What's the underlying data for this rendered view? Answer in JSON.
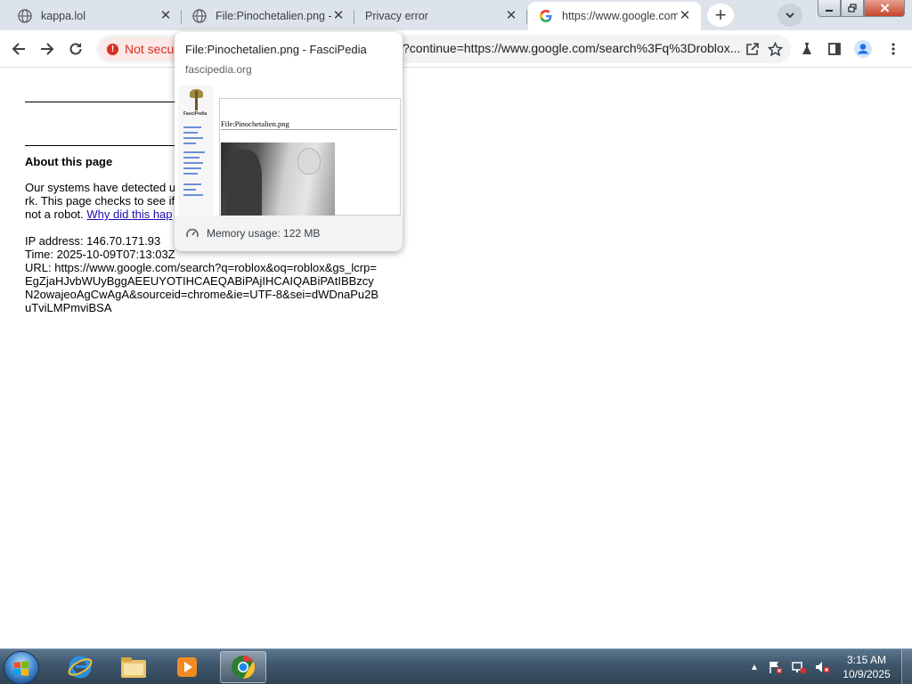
{
  "browser": {
    "tabs": [
      {
        "title": "kappa.lol",
        "favicon": "globe-icon"
      },
      {
        "title": "File:Pinochetalien.png - FasciPedia",
        "favicon": "globe-icon"
      },
      {
        "title": "Privacy error",
        "favicon": "none"
      },
      {
        "title": "https://www.google.com/sorry",
        "favicon": "google-g-icon",
        "active": true
      }
    ],
    "new_tab_label": "+",
    "close_glyph": "✕",
    "toolbar": {
      "security_chip": "Not secure",
      "url": "?continue=https://www.google.com/search%3Fq%3Droblox..."
    }
  },
  "page": {
    "heading": "About this page",
    "para_lines": [
      "Our systems have detected u",
      "rk. This page checks to see if",
      "not a robot."
    ],
    "link": "Why did this hap",
    "ip_line": "IP address: 146.70.171.93",
    "time_line": "Time: 2025-10-09T07:13:03Z",
    "url_lines": [
      "URL: https://www.google.com/search?q=roblox&oq=roblox&gs_lcrp=",
      "EgZjaHJvbWUyBggAEEUYOTIHCAEQABiPAjIHCAIQABiPAtIBBzcy",
      "N2owajeoAgCwAgA&sourceid=chrome&ie=UTF-8&sei=dWDnaPu2B",
      "uTviLMPmviBSA"
    ]
  },
  "hovercard": {
    "title": "File:Pinochetalien.png - FasciPedia",
    "domain": "fascipedia.org",
    "preview_heading": "File:Pinochetalien.png",
    "preview_logo_text": "FasciPedia",
    "memory": "Memory usage: 122 MB"
  },
  "taskbar": {
    "time": "3:15 AM",
    "date": "10/9/2025",
    "apps": [
      "internet-explorer-icon",
      "file-explorer-icon",
      "media-player-icon",
      "chrome-icon"
    ]
  },
  "colors": {
    "tabstrip": "#dde3ea",
    "warning_red": "#d93025",
    "link_blue": "#1a0dab"
  }
}
